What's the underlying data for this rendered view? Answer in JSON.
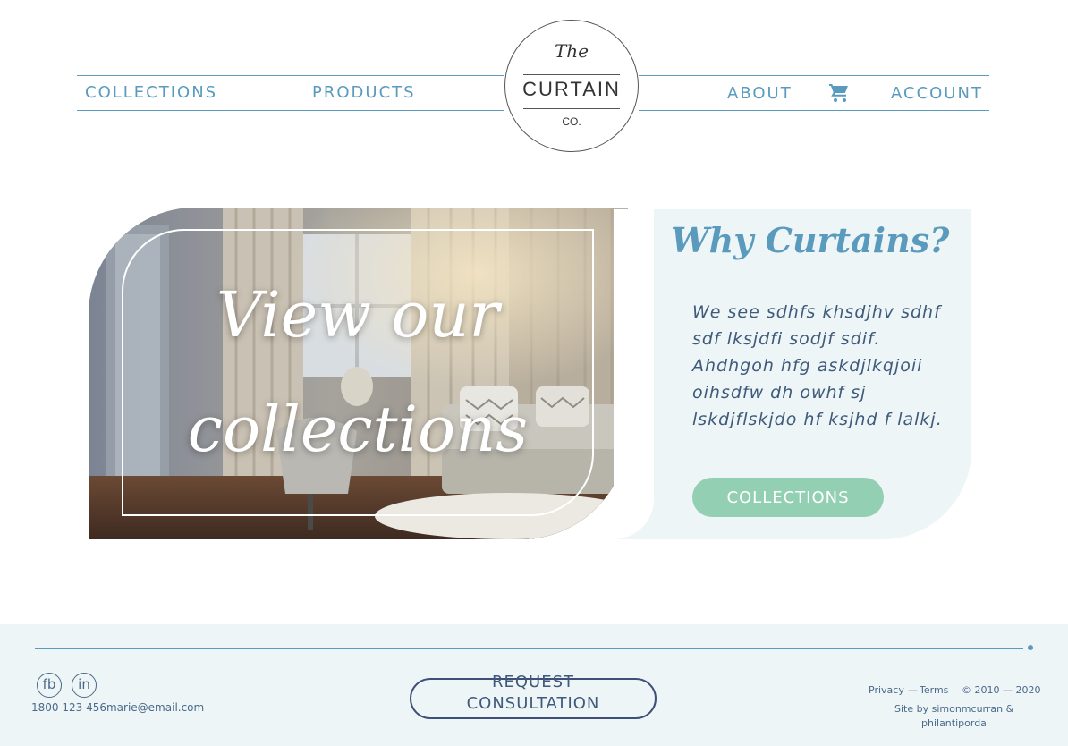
{
  "nav": {
    "collections": "COLLECTIONS",
    "products": "PRODUCTS",
    "about": "ABOUT",
    "account": "ACCOUNT",
    "cart_icon": "cart-icon"
  },
  "logo": {
    "the": "The",
    "name": "CURTAIN",
    "suffix": "CO."
  },
  "hero": {
    "title_line1": "View our",
    "title_line2": "collections"
  },
  "info": {
    "heading": "Why Curtains?",
    "body": "We see sdhfs khsdjhv sdhf sdf lksjdfi  sodjf sdif. Ahdhgoh hfg  askdjlkqjoii oihsdfw  dh  owhf sj lskdjflskjdo hf  ksjhd f lalkj.",
    "button": "COLLECTIONS"
  },
  "footer": {
    "social": [
      "fb",
      "in"
    ],
    "phone": "1800 123 456",
    "email": "marie@email.com",
    "consult_line1": "REQUEST",
    "consult_line2": "CONSULTATION",
    "privacy": "Privacy",
    "dash": "—",
    "terms": "Terms",
    "copyright": "© 2010 — 2020",
    "credit_line1": "Site by simonmcurran &",
    "credit_line2": "philantiporda"
  },
  "colors": {
    "accent": "#5a9bbd",
    "panel": "#edf5f7",
    "button": "#93cfb3",
    "text": "#3f5a7a"
  }
}
